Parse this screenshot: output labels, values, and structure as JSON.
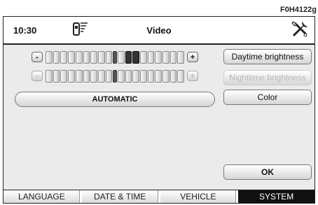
{
  "figure_code": "F0H4122g",
  "header": {
    "time": "10:30",
    "title": "Video",
    "phone_icon": "phone-signal-icon",
    "settings_icon": "tools-icon"
  },
  "sliders": [
    {
      "minus_label": "-",
      "plus_label": "+",
      "level": 0.6,
      "enabled": true
    },
    {
      "minus_label": "-",
      "plus_label": "+",
      "level": 0.5,
      "enabled": false
    }
  ],
  "automatic_label": "AUTOMATIC",
  "right_buttons": {
    "daytime_label": "Daytime brightness",
    "nighttime_label": "Nighttime brightness",
    "color_label": "Color",
    "ok_label": "OK"
  },
  "tabs": [
    {
      "label": "LANGUAGE",
      "active": false
    },
    {
      "label": "DATE & TIME",
      "active": false
    },
    {
      "label": "VEHICLE",
      "active": false
    },
    {
      "label": "SYSTEM",
      "active": true
    }
  ]
}
